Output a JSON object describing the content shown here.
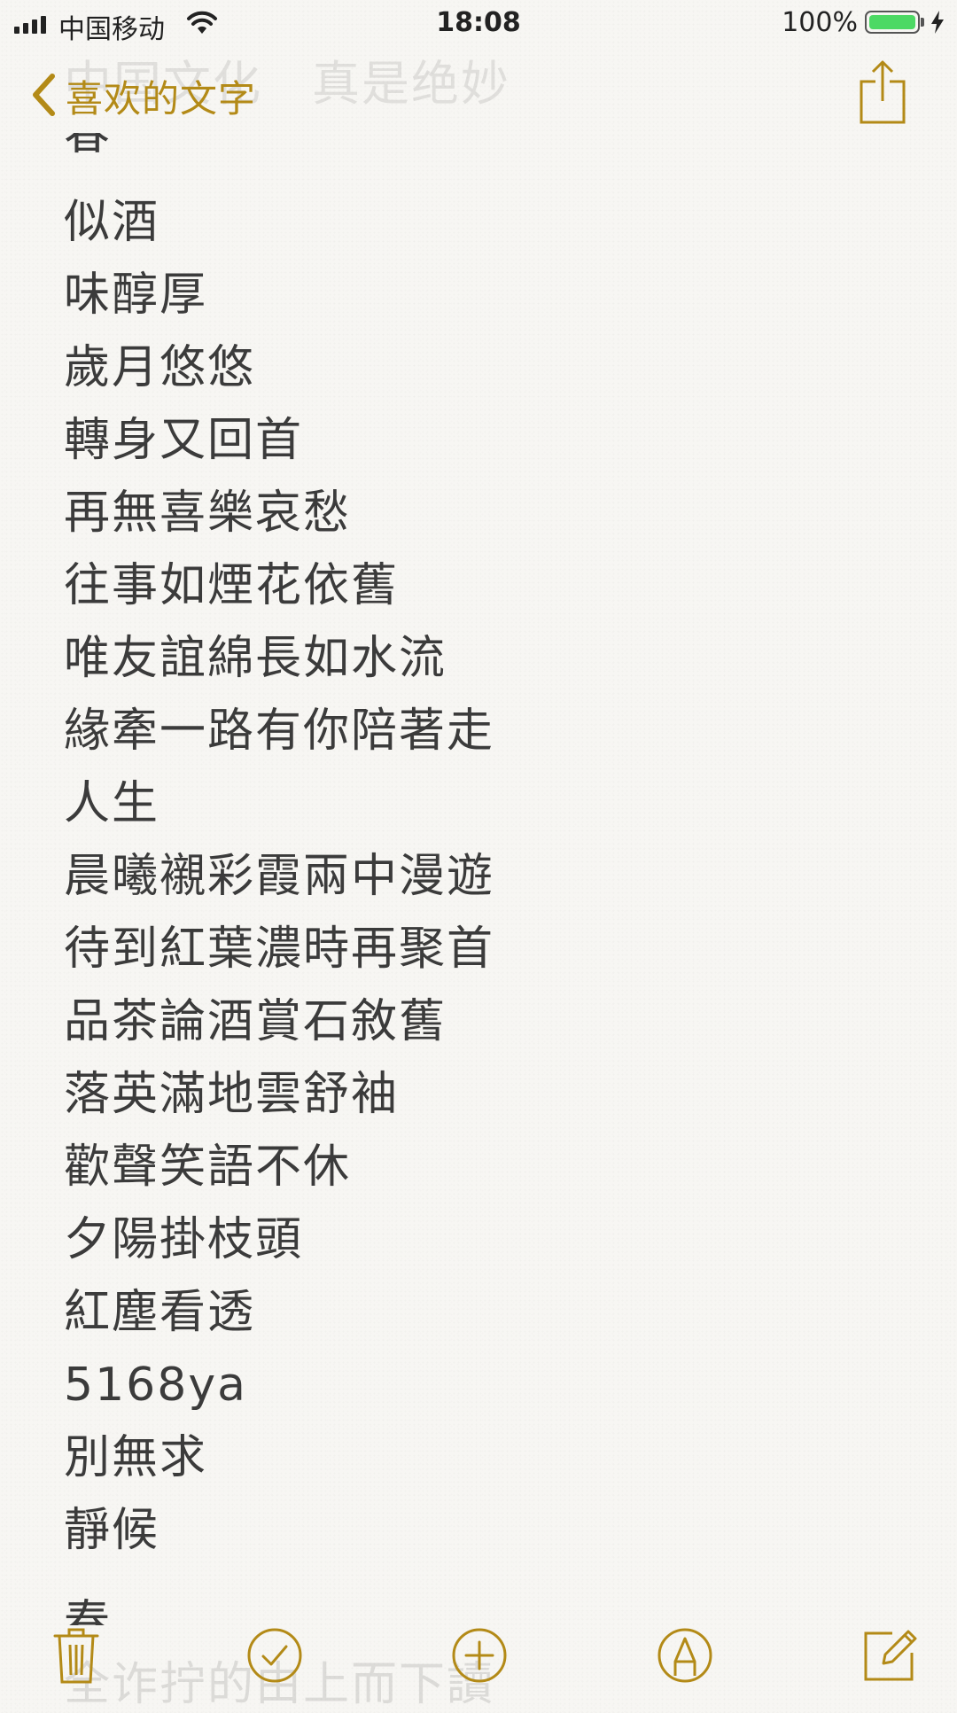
{
  "status_bar": {
    "carrier": "中国移动",
    "time": "18:08",
    "battery_percent": "100%",
    "battery_level": 1.0,
    "battery_color": "#4cd964",
    "signal_bars": 4
  },
  "nav": {
    "back_label": "喜欢的文字",
    "faded_heading": "中国文化　真是绝妙",
    "accent_color": "#b38a17",
    "back_icon": "chevron-left-icon",
    "share_icon": "share-icon"
  },
  "note": {
    "top_partial": "春",
    "lines": [
      "似酒",
      "味醇厚",
      "歲月悠悠",
      "轉身又回首",
      "再無喜樂哀愁",
      "往事如煙花依舊",
      "唯友誼綿長如水流",
      "緣牽一路有你陪著走",
      "人生",
      "晨曦襯彩霞兩中漫遊",
      "待到紅葉濃時再聚首",
      "品茶論酒賞石敘舊",
      "落英滿地雲舒袖",
      "歡聲笑語不休",
      "夕陽掛枝頭",
      "紅塵看透",
      "5168ya",
      "別無求",
      "靜候"
    ],
    "bottom_partial": "春",
    "faded_tail": "全诈拧的由上而下讀"
  },
  "toolbar": {
    "icons": [
      "trash-icon",
      "checklist-icon",
      "add-icon",
      "markup-icon",
      "compose-icon"
    ]
  }
}
